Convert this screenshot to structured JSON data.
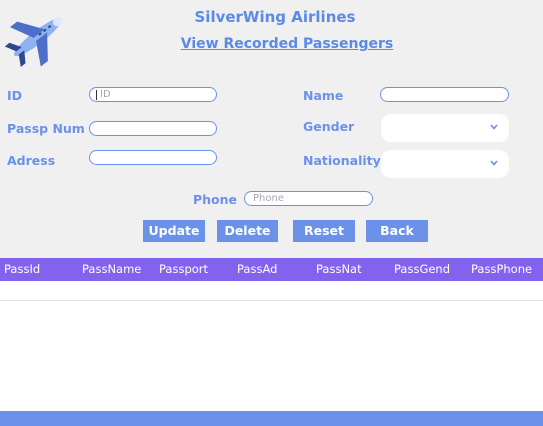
{
  "header": {
    "title": "SilverWing Airlines",
    "subtitle": "View Recorded Passengers",
    "logo_icon": "airplane-icon"
  },
  "form": {
    "id_label": "ID",
    "id_placeholder": "ID",
    "name_label": "Name",
    "passp_label": "Passp Num",
    "gender_label": "Gender",
    "adress_label": "Adress",
    "nationality_label": "Nationality",
    "phone_label": "Phone",
    "phone_placeholder": "Phone"
  },
  "buttons": {
    "update": "Update",
    "delete": "Delete",
    "reset": "Reset",
    "back": "Back"
  },
  "table": {
    "columns": [
      "PassId",
      "PassName",
      "Passport",
      "PassAd",
      "PassNat",
      "PassGend",
      "PassPhone"
    ],
    "rows": []
  },
  "colors": {
    "accent": "#6b92e8",
    "table_header": "#8363ee",
    "background": "#f0f0f0"
  }
}
